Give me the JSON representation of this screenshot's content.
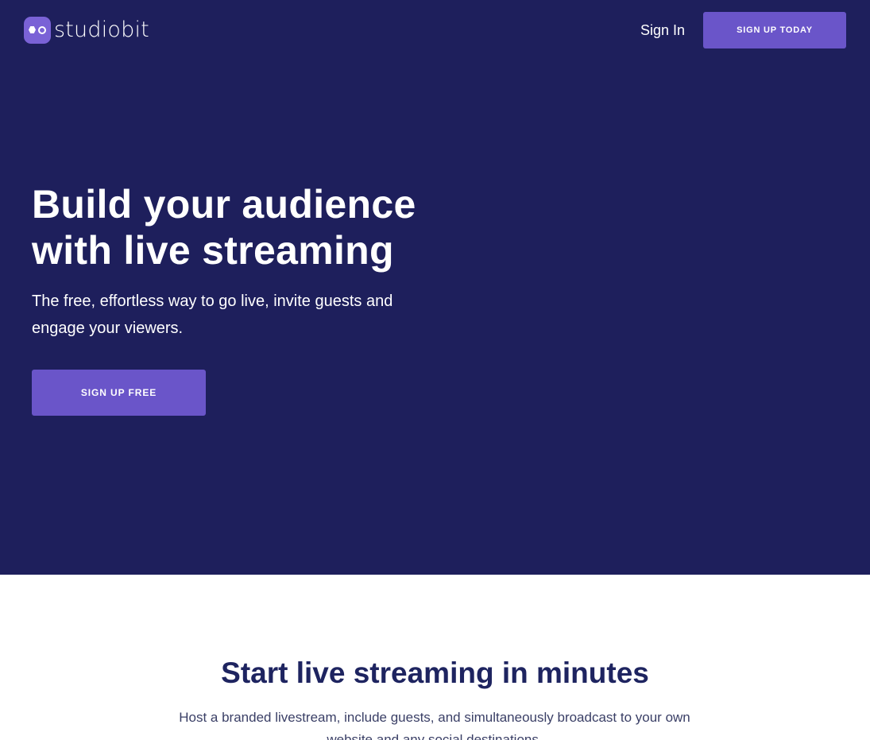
{
  "brand": {
    "name": "studiobit",
    "logo_icon": "studiobit-logo-icon",
    "accent_color": "#6a55c9",
    "hero_background": "#1e1f5c"
  },
  "nav": {
    "sign_in": "Sign In",
    "sign_up": "SIGN UP TODAY"
  },
  "hero": {
    "headline": "Build your audience with live streaming",
    "subheadline": "The free, effortless way to go live, invite guests and engage your viewers.",
    "cta": "SIGN UP FREE"
  },
  "features": {
    "title": "Start live streaming in minutes",
    "description": "Host a branded livestream, include guests, and simultaneously broadcast to your own website and any social destinations."
  }
}
